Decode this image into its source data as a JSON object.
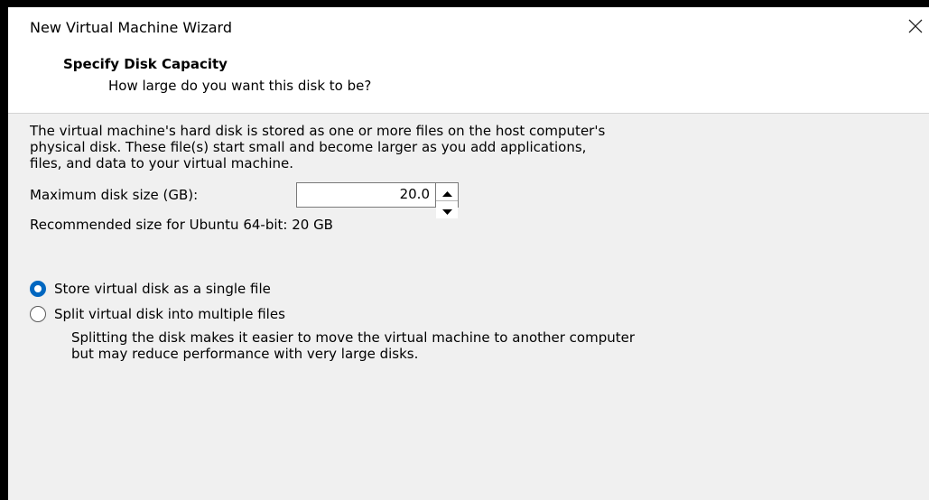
{
  "window": {
    "title": "New Virtual Machine Wizard"
  },
  "header": {
    "title": "Specify Disk Capacity",
    "subtitle": "How large do you want this disk to be?"
  },
  "description": {
    "lines": [
      "The virtual machine's hard disk is stored as one or more files on the host computer's",
      "physical disk. These file(s) start small and become larger as you add applications,",
      "files, and data to your virtual machine."
    ]
  },
  "disk_size": {
    "label": "Maximum disk size (GB):",
    "value": "20.0"
  },
  "recommendation": "Recommended size for Ubuntu 64-bit: 20 GB",
  "storage_options": {
    "single_file": {
      "label": "Store virtual disk as a single file",
      "selected": true
    },
    "split_files": {
      "label": "Split virtual disk into multiple files",
      "selected": false
    }
  },
  "split_help": {
    "lines": [
      "Splitting the disk makes it easier to move the virtual machine to another computer",
      "but may reduce performance with very large disks."
    ]
  },
  "colors": {
    "accent": "#0067c0",
    "dialog_background": "#f0f0f0",
    "header_background": "#ffffff"
  },
  "icons": {
    "close": "close-icon",
    "spin_up": "chevron-up-icon",
    "spin_down": "chevron-down-icon"
  }
}
